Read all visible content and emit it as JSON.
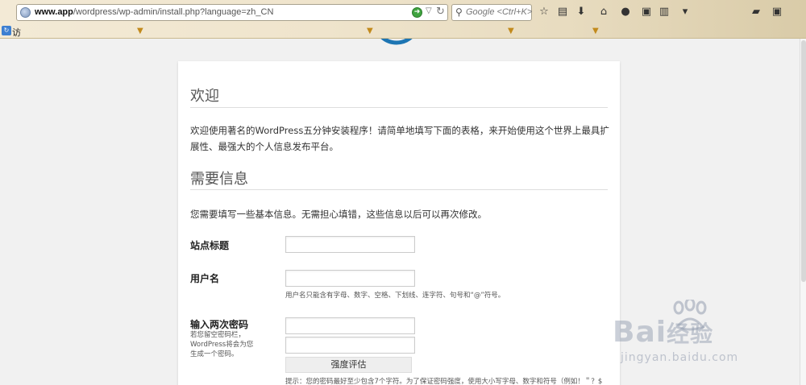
{
  "browser": {
    "url_host": "www.app",
    "url_path": "/wordpress/wp-admin/install.php?language=zh_CN",
    "search_placeholder": "Google <Ctrl+K>",
    "bookmark_label": "访"
  },
  "page": {
    "welcome": {
      "heading": "欢迎",
      "text": "欢迎使用著名的WordPress五分钟安装程序！请简单地填写下面的表格，来开始使用这个世界上最具扩展性、最强大的个人信息发布平台。"
    },
    "info": {
      "heading": "需要信息",
      "text": "您需要填写一些基本信息。无需担心填错，这些信息以后可以再次修改。"
    },
    "form": {
      "site_title_label": "站点标题",
      "site_title_value": "",
      "username_label": "用户名",
      "username_value": "",
      "username_hint": "用户名只能含有字母、数字、空格、下划线、连字符、句号和“@”符号。",
      "password_label": "输入两次密码",
      "password_note": "若您留空密码栏，WordPress将会为您生成一个密码。",
      "password1_value": "",
      "password2_value": "",
      "strength_label": "强度评估",
      "password_hint": "提示：您的密码最好至少包含7个字符。为了保证密码强度，使用大小写字母、数字和符号（例如！＂？$"
    }
  },
  "watermark": {
    "brand": "Bai",
    "brand_cn": "经验",
    "site": "jingyan.baidu.com"
  }
}
